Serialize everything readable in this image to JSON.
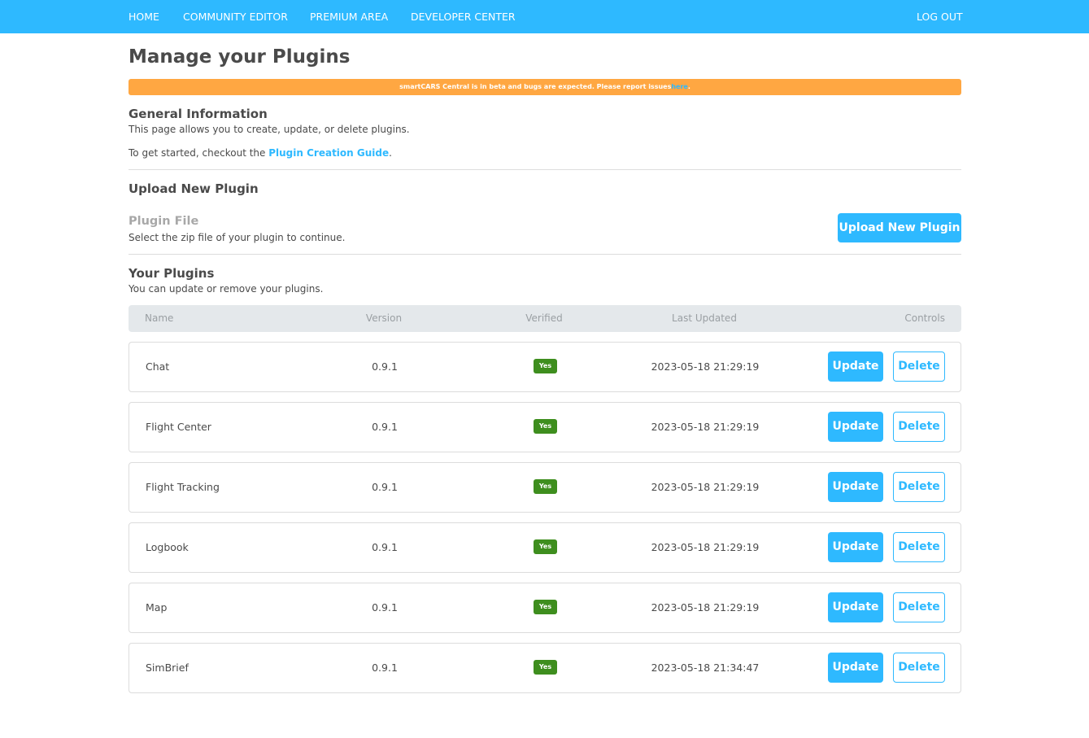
{
  "nav": {
    "home": "HOME",
    "community_editor": "COMMUNITY EDITOR",
    "premium_area": "PREMIUM AREA",
    "developer_center": "DEVELOPER CENTER",
    "logout": "LOG OUT"
  },
  "page": {
    "title": "Manage your Plugins"
  },
  "banner": {
    "text": "smartCARS Central is in beta and bugs are expected. Please report issues",
    "link_text": "here",
    "suffix": ".",
    "color": "#ffa742"
  },
  "general_info": {
    "heading": "General Information",
    "description": "This page allows you to create, update, or delete plugins.",
    "guide_prefix": "To get started, checkout the ",
    "guide_link": "Plugin Creation Guide",
    "guide_suffix": "."
  },
  "upload": {
    "heading": "Upload New Plugin",
    "field_label": "Plugin File",
    "field_hint": "Select the zip file of your plugin to continue.",
    "button_label": "Upload New Plugin"
  },
  "plugins": {
    "heading": "Your Plugins",
    "description": "You can update or remove your plugins.",
    "columns": {
      "name": "Name",
      "version": "Version",
      "verified": "Verified",
      "last_updated": "Last Updated",
      "controls": "Controls"
    },
    "rows": [
      {
        "name": "Chat",
        "version": "0.9.1",
        "verified": "Yes",
        "last_updated": "2023-05-18 21:29:19",
        "update_label": "Update",
        "delete_label": "Delete"
      },
      {
        "name": "Flight Center",
        "version": "0.9.1",
        "verified": "Yes",
        "last_updated": "2023-05-18 21:29:19",
        "update_label": "Update",
        "delete_label": "Delete"
      },
      {
        "name": "Flight Tracking",
        "version": "0.9.1",
        "verified": "Yes",
        "last_updated": "2023-05-18 21:29:19",
        "update_label": "Update",
        "delete_label": "Delete"
      },
      {
        "name": "Logbook",
        "version": "0.9.1",
        "verified": "Yes",
        "last_updated": "2023-05-18 21:29:19",
        "update_label": "Update",
        "delete_label": "Delete"
      },
      {
        "name": "Map",
        "version": "0.9.1",
        "verified": "Yes",
        "last_updated": "2023-05-18 21:29:19",
        "update_label": "Update",
        "delete_label": "Delete"
      },
      {
        "name": "SimBrief",
        "version": "0.9.1",
        "verified": "Yes",
        "last_updated": "2023-05-18 21:34:47",
        "update_label": "Update",
        "delete_label": "Delete"
      }
    ]
  },
  "colors": {
    "accent": "#2eb9ff",
    "verified": "#3e8e1e",
    "table_header": "#e4e8eb"
  }
}
